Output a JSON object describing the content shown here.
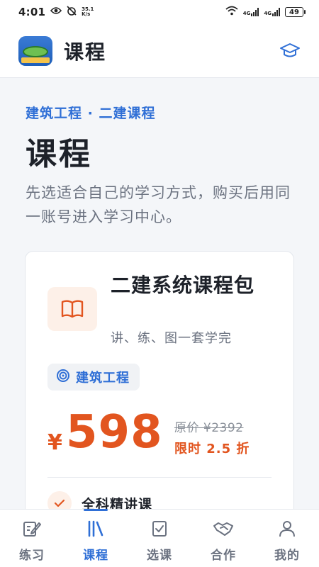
{
  "status_bar": {
    "time": "4:01",
    "speed_value": "35.1",
    "speed_unit": "K/s",
    "sim1": "4G",
    "sim2": "4G",
    "battery": "49"
  },
  "header": {
    "title": "课程",
    "logo_icon": "stadium-logo-icon",
    "right_icon": "graduation-cap-icon"
  },
  "page": {
    "breadcrumb": "建筑工程 · 二建课程",
    "title": "课程",
    "description": "先选适合自己的学习方式，购买后用同一账号进入学习中心。"
  },
  "course_card": {
    "icon": "book-icon",
    "title": "二建系统课程包",
    "subtitle": "讲、练、图一套学完",
    "tag": "建筑工程",
    "currency": "¥",
    "price": "598",
    "original_price": "原价 ¥2392",
    "discount": "限时 2.5 折",
    "features": [
      "全科精讲课"
    ]
  },
  "bottom_nav": {
    "items": [
      {
        "label": "练习",
        "icon": "edit-note-icon"
      },
      {
        "label": "课程",
        "icon": "books-icon",
        "active": true
      },
      {
        "label": "选课",
        "icon": "checkbox-icon"
      },
      {
        "label": "合作",
        "icon": "handshake-icon"
      },
      {
        "label": "我的",
        "icon": "user-icon"
      }
    ]
  },
  "colors": {
    "accent": "#2f6fd6",
    "price": "#e2551f",
    "background": "#f4f6f9"
  }
}
